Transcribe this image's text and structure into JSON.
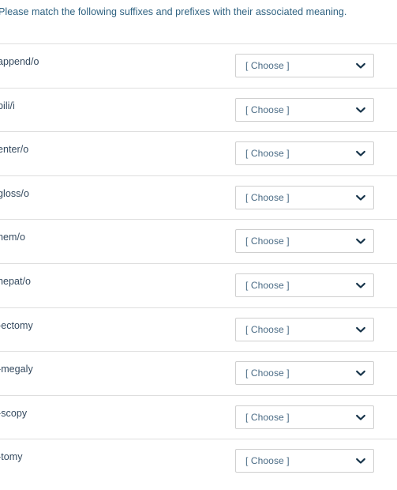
{
  "instruction": {
    "text": "Please match the following suffixes and prefixes with their associated meaning."
  },
  "select": {
    "placeholder": "[ Choose ]",
    "chevron_icon": "chevron-down-icon"
  },
  "colors": {
    "instruction_text": "#2e6180",
    "term_text": "#34495e",
    "select_text": "#4a6b85",
    "select_border": "#cfcfcf",
    "row_divider": "#dedede",
    "chevron": "#17344a",
    "background": "#ffffff"
  },
  "rows": [
    {
      "term": "append/o",
      "value": "[ Choose ]"
    },
    {
      "term": "bili/i",
      "value": "[ Choose ]"
    },
    {
      "term": "enter/o",
      "value": "[ Choose ]"
    },
    {
      "term": "gloss/o",
      "value": "[ Choose ]"
    },
    {
      "term": "hem/o",
      "value": "[ Choose ]"
    },
    {
      "term": "hepat/o",
      "value": "[ Choose ]"
    },
    {
      "term": "-ectomy",
      "value": "[ Choose ]"
    },
    {
      "term": "-megaly",
      "value": "[ Choose ]"
    },
    {
      "term": "-scopy",
      "value": "[ Choose ]"
    },
    {
      "term": "-tomy",
      "value": "[ Choose ]"
    }
  ]
}
